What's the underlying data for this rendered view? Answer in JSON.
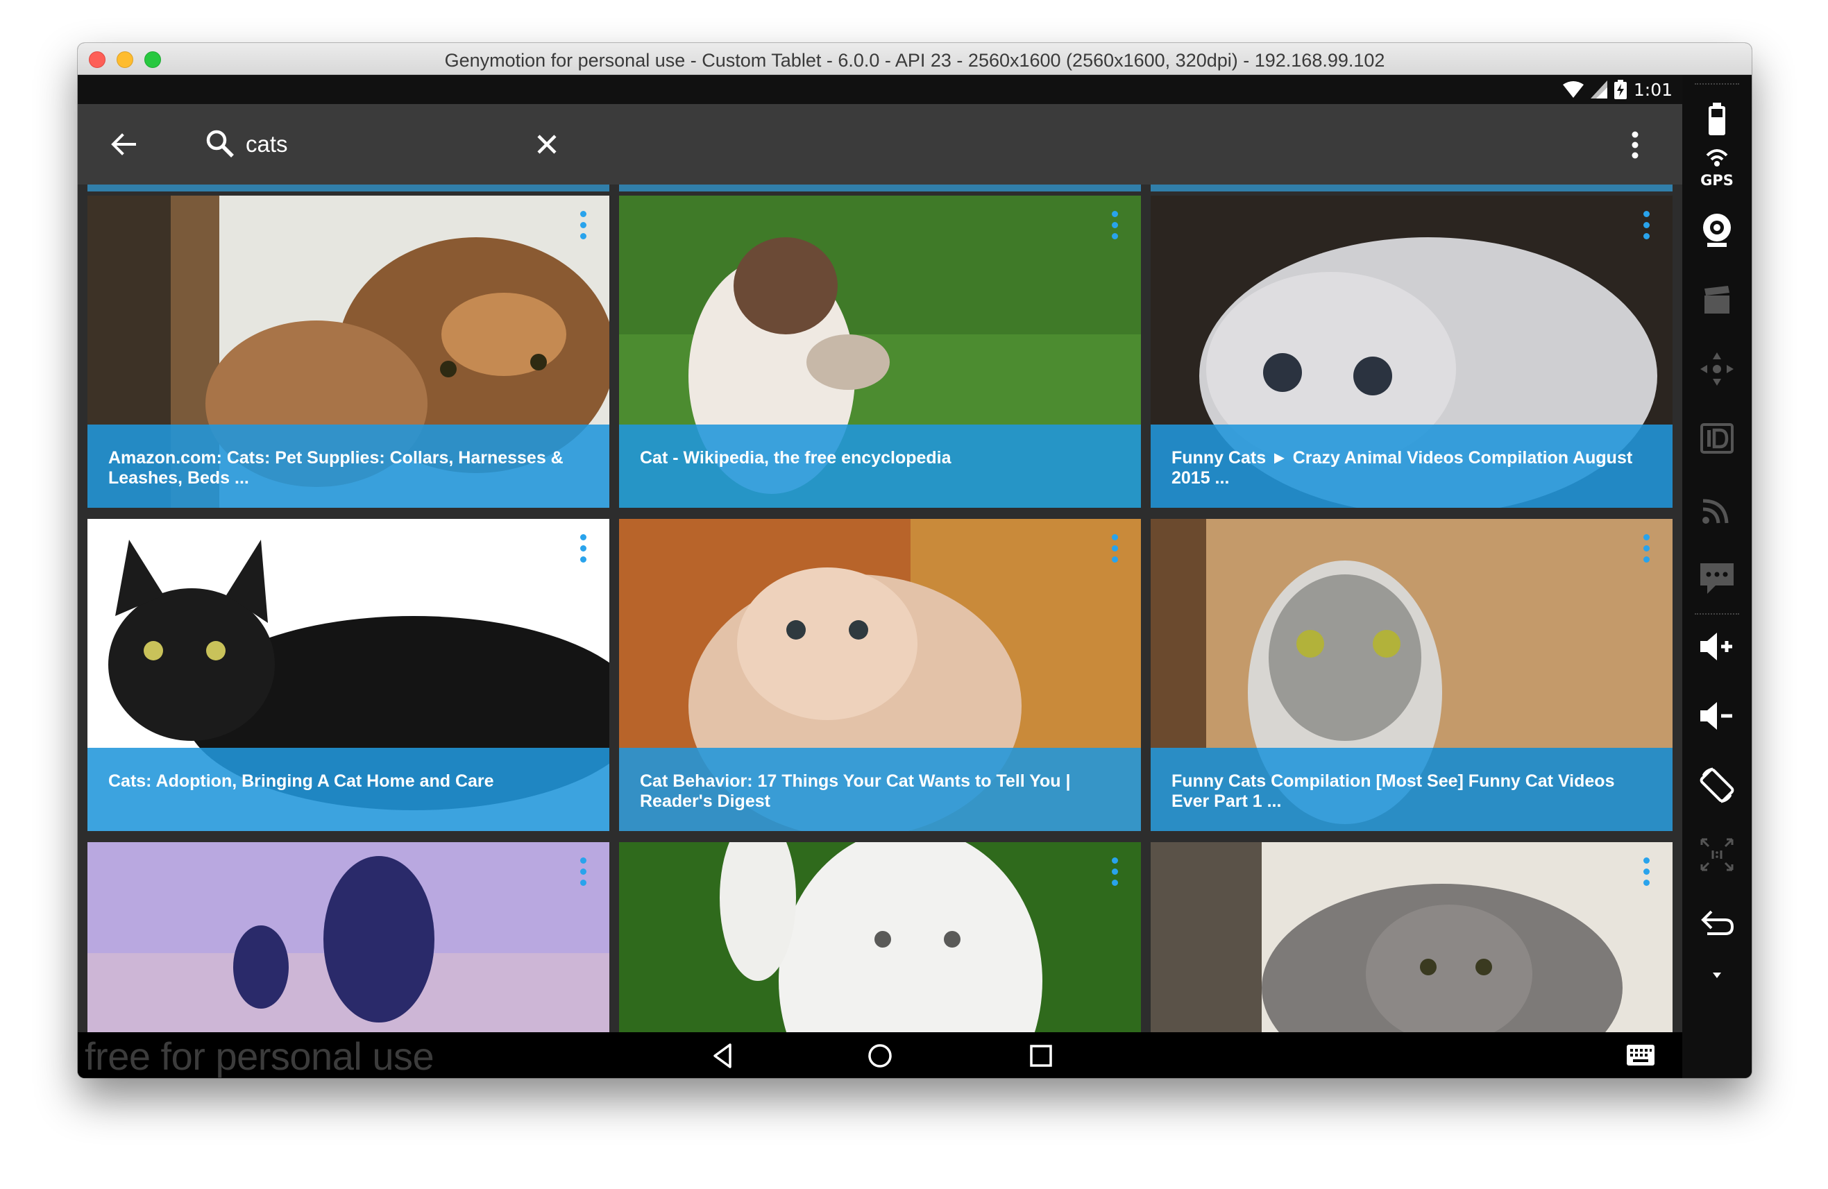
{
  "window": {
    "title": "Genymotion for personal use - Custom Tablet - 6.0.0 - API 23 - 2560x1600 (2560x1600, 320dpi) - 192.168.99.102"
  },
  "statusbar": {
    "time": "1:01",
    "icons": [
      "wifi-icon",
      "signal-icon",
      "battery-charging-icon"
    ]
  },
  "appbar": {
    "search_value": "cats",
    "icons": [
      "back-arrow-icon",
      "search-icon",
      "close-icon",
      "more-vert-icon"
    ]
  },
  "results": [
    {
      "caption": "Amazon.com: Cats: Pet Supplies: Collars, Harnesses & Leashes, Beds ..."
    },
    {
      "caption": "Cat - Wikipedia, the free encyclopedia"
    },
    {
      "caption": "Funny Cats ► Crazy Animal Videos Compilation August 2015 ..."
    },
    {
      "caption": "Cats: Adoption, Bringing A Cat Home and Care"
    },
    {
      "caption": "Cat Behavior: 17 Things Your Cat Wants to Tell You | Reader's Digest"
    },
    {
      "caption": "Funny Cats Compilation [Most See] Funny Cat Videos Ever Part 1 ..."
    },
    {
      "caption": ""
    },
    {
      "caption": ""
    },
    {
      "caption": ""
    }
  ],
  "navbar": {
    "watermark": "free for personal use",
    "icons": [
      "nav-back-icon",
      "nav-home-icon",
      "nav-recents-icon",
      "keyboard-icon"
    ]
  },
  "sidepanel": {
    "gps_label": "GPS",
    "icons": [
      "battery-icon",
      "gps-icon",
      "webcam-icon",
      "capture-icon",
      "dpad-icon",
      "id-icon",
      "cast-icon",
      "sms-icon",
      "volume-up-icon",
      "volume-down-icon",
      "rotate-icon",
      "pixel-perfect-icon",
      "back-icon",
      "expand-icon"
    ]
  },
  "colors": {
    "caption_bg": "#2196db",
    "accent": "#29a3ec",
    "appbar": "#3b3b3b",
    "statusbar": "#111111"
  }
}
